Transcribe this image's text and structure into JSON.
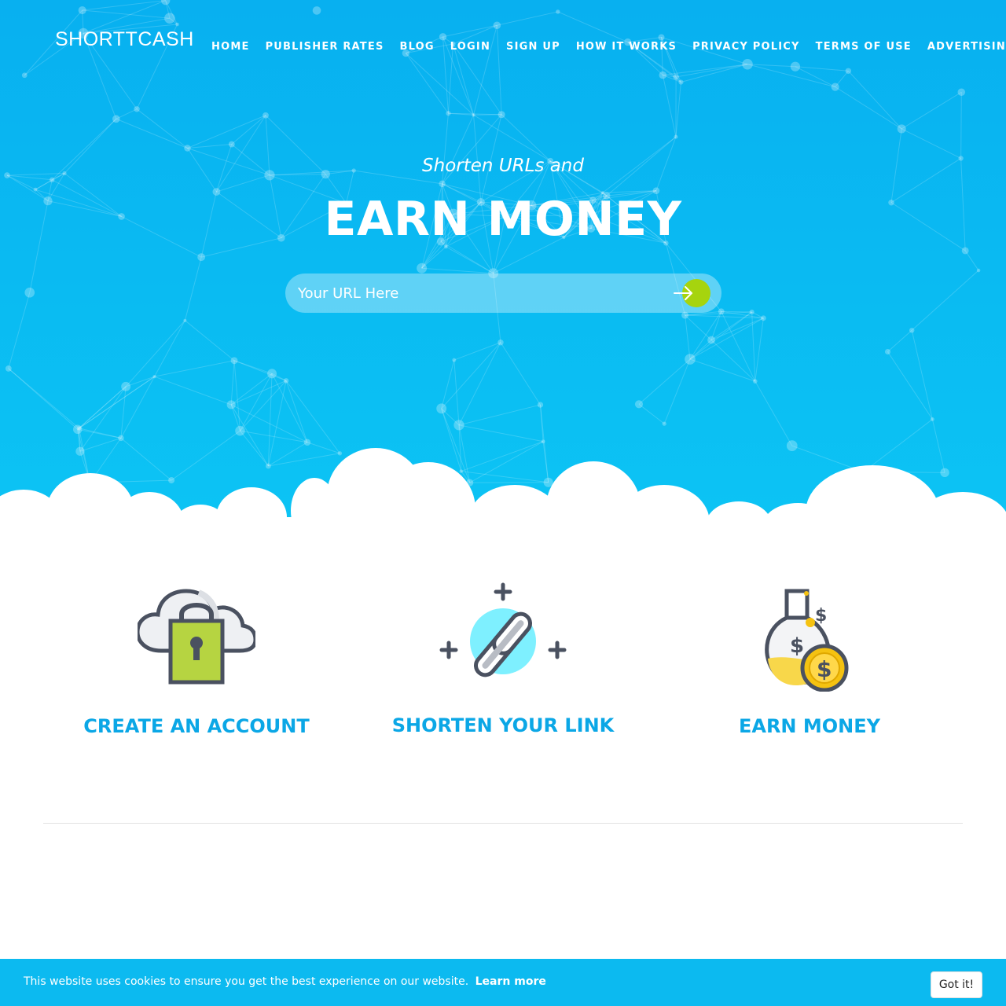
{
  "brand": {
    "logo_text": "SHORTTCASH"
  },
  "nav": {
    "items": [
      {
        "label": "HOME"
      },
      {
        "label": "PUBLISHER RATES"
      },
      {
        "label": "BLOG"
      },
      {
        "label": "LOGIN"
      },
      {
        "label": "SIGN UP"
      },
      {
        "label": "HOW IT WORKS"
      },
      {
        "label": "PRIVACY POLICY"
      },
      {
        "label": "TERMS OF USE"
      },
      {
        "label": "ADVERTISING RATES"
      }
    ]
  },
  "hero": {
    "tagline": "Shorten URLs and",
    "headline": "EARN MONEY",
    "url_input": {
      "placeholder": "Your URL Here",
      "value": ""
    },
    "submit_icon": "arrow-right-icon"
  },
  "features": [
    {
      "label": "CREATE AN ACCOUNT",
      "icon": "cloud-lock-icon"
    },
    {
      "label": "SHORTEN YOUR LINK",
      "icon": "chain-link-icon"
    },
    {
      "label": "EARN MONEY",
      "icon": "money-flask-icon"
    }
  ],
  "cookie_bar": {
    "message": "This website uses cookies to ensure you get the best experience on our website.",
    "link_label": "Learn more",
    "button_label": "Got it!"
  },
  "colors": {
    "hero_bg": "#08b0f0",
    "accent_green": "#a6d40e",
    "feature_label": "#0ba7e6",
    "cookie_bar_bg": "#0cbaf0"
  }
}
